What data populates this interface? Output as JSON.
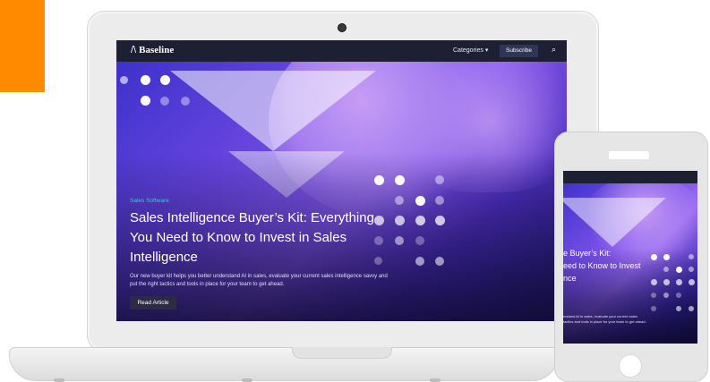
{
  "brand": {
    "name": "Baseline",
    "mark": "/\\"
  },
  "nav": {
    "categories_label": "Categories",
    "caret": "▾",
    "subscribe_label": "Subscribe",
    "search_glyph": "⌕"
  },
  "article": {
    "category": "Sales Software",
    "title": "Sales Intelligence Buyer’s Kit: Everything You Need to Know to Invest in Sales Intelligence",
    "description": "Our new buyer kit helps you better understand AI in sales, evaluate your current sales intelligence savvy and put the right tactics and tools in place for your team to get ahead.",
    "cta_label": "Read Article"
  },
  "mobile": {
    "title_lines": [
      "e Buyer’s Kit:",
      "eed to Know to Invest",
      "nce"
    ],
    "description_lines": [
      "erstand AI in sales, evaluate your current sales",
      "tactics and tools in place for your team to get ahead."
    ]
  },
  "colors": {
    "accent": "#ff8a00",
    "navbar": "#1d1f33",
    "kicker": "#29d3d1",
    "button": "#2b2c44"
  },
  "icons": [
    "search-icon",
    "camera-icon",
    "home-button-icon",
    "chevron-down-icon"
  ]
}
